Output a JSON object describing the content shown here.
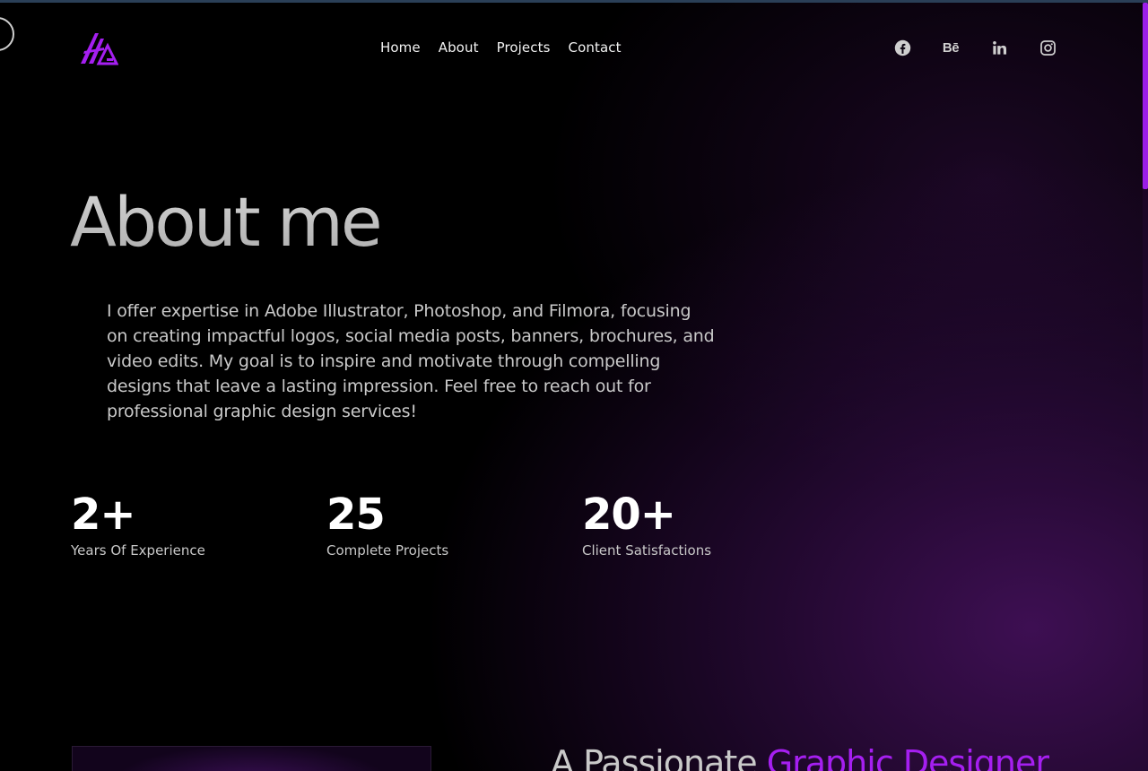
{
  "brand": {
    "logo_text": "HG",
    "accent_color": "#a51ff0"
  },
  "nav": {
    "items": [
      {
        "label": "Home"
      },
      {
        "label": "About"
      },
      {
        "label": "Projects"
      },
      {
        "label": "Contact"
      }
    ]
  },
  "socials": {
    "items": [
      {
        "name": "facebook-icon"
      },
      {
        "name": "behance-icon",
        "text": "Bē"
      },
      {
        "name": "linkedin-icon"
      },
      {
        "name": "instagram-icon"
      }
    ]
  },
  "about": {
    "title": "About me",
    "description": "I offer expertise in Adobe Illustrator, Photoshop, and Filmora, focusing on creating impactful logos, social media posts, banners, brochures, and video edits. My goal is to inspire and motivate through compelling designs that leave a lasting impression. Feel free to reach out for professional graphic design services!"
  },
  "stats": [
    {
      "value": "2+",
      "label": "Years Of Experience"
    },
    {
      "value": "25",
      "label": "Complete Projects"
    },
    {
      "value": "20+",
      "label": "Client Satisfactions"
    }
  ],
  "intro": {
    "heading_prefix": "A Passionate ",
    "heading_accent": "Graphic Designer"
  }
}
